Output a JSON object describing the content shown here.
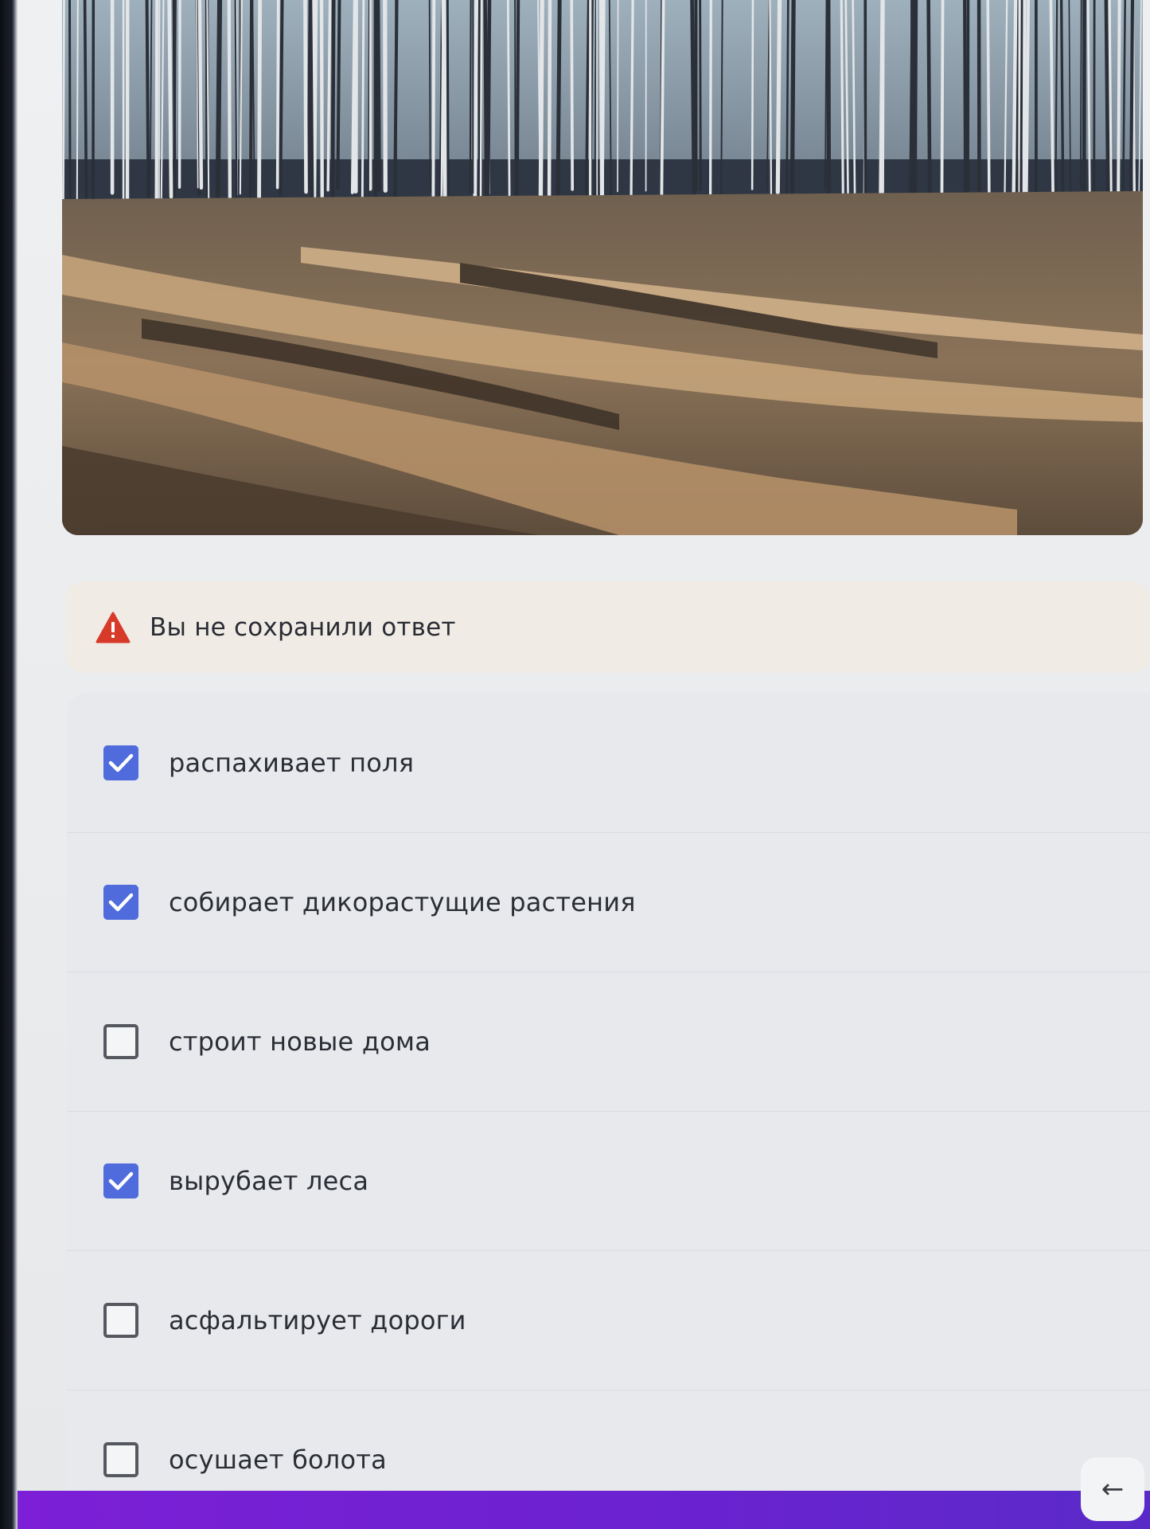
{
  "warning": {
    "icon": "warning-triangle-icon",
    "text": "Вы не сохранили ответ",
    "color": "#d83a2a"
  },
  "options": [
    {
      "label": "распахивает поля",
      "checked": true
    },
    {
      "label": "собирает дикорастущие растения",
      "checked": true
    },
    {
      "label": "строит новые дома",
      "checked": false
    },
    {
      "label": "вырубает леса",
      "checked": true
    },
    {
      "label": "асфальтирует дороги",
      "checked": false
    },
    {
      "label": "осушает болота",
      "checked": false
    }
  ],
  "accent_color": "#4f6bdc",
  "footer": {
    "back_icon": "arrow-left-icon",
    "back_glyph": "←",
    "bar_color": "#7c1fd6"
  }
}
